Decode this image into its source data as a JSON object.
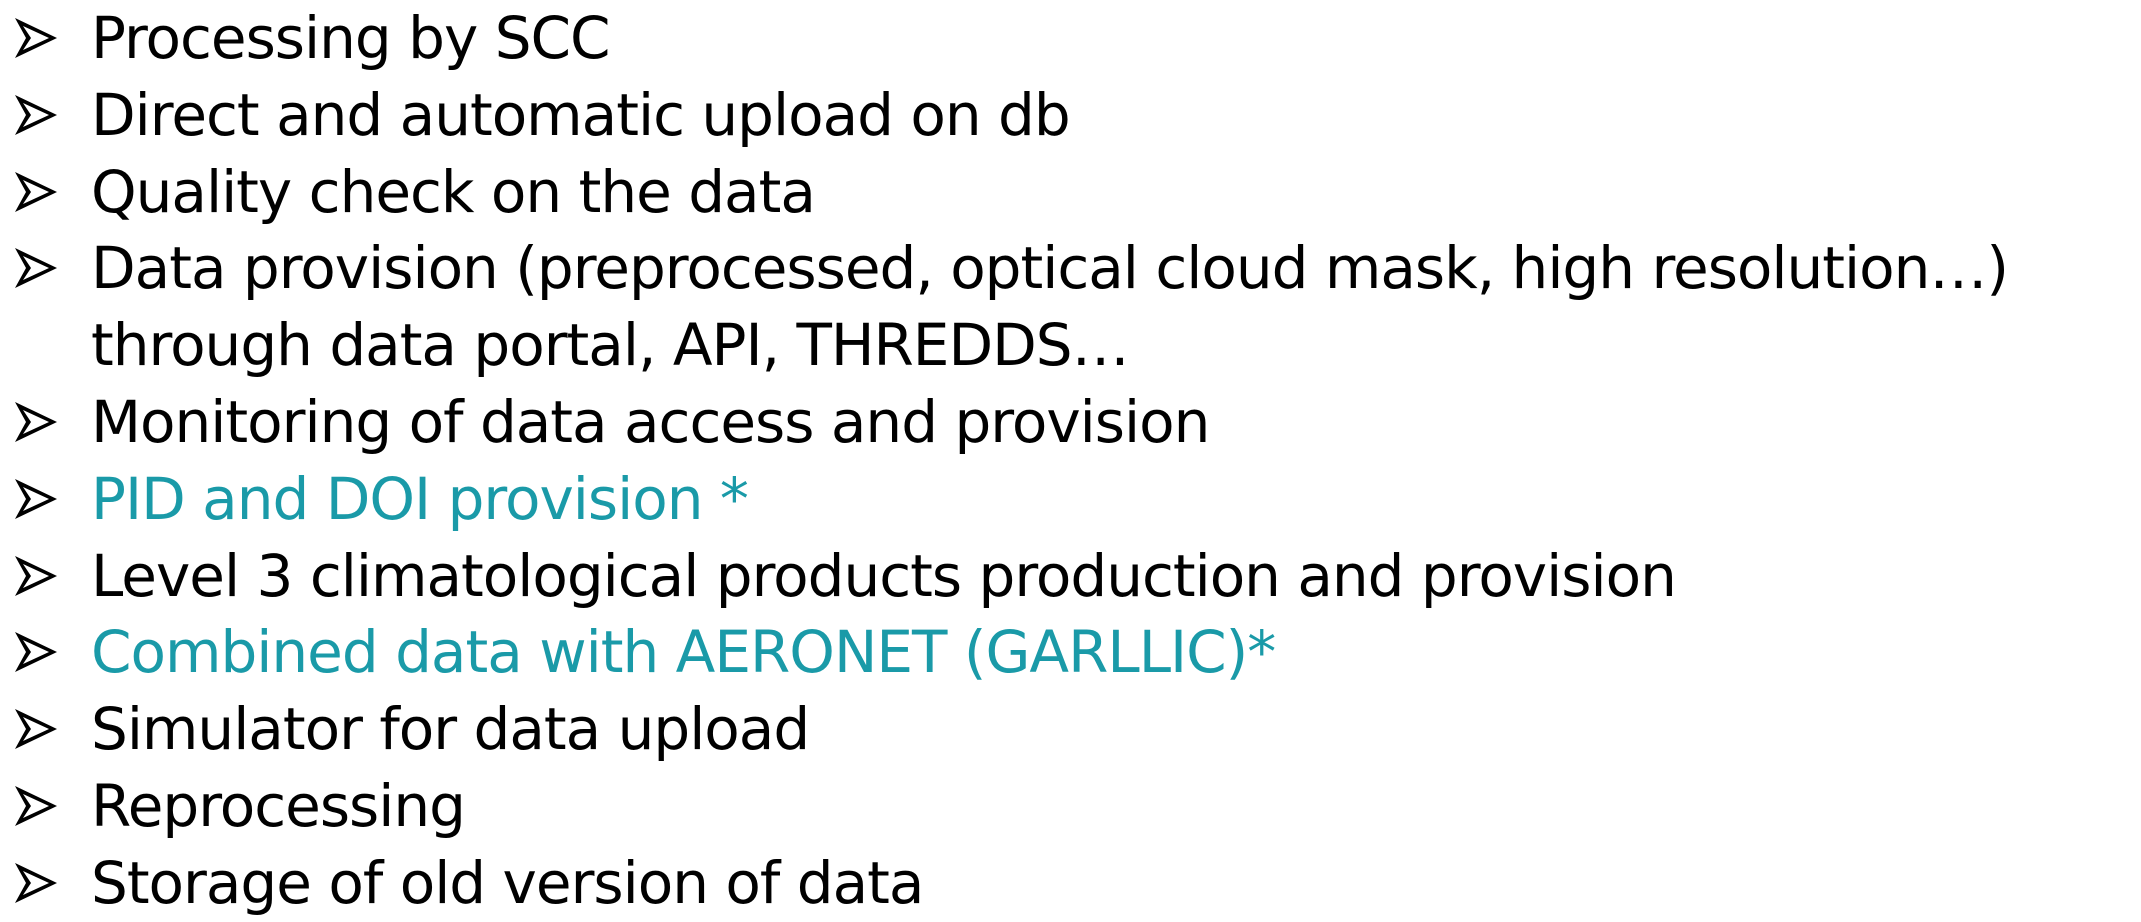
{
  "list": {
    "items": [
      {
        "text": "Processing by SCC",
        "accent": false
      },
      {
        "text": "Direct and automatic upload on db",
        "accent": false
      },
      {
        "text": "Quality check on the data",
        "accent": false
      },
      {
        "text": "Data provision (preprocessed, optical cloud mask, high resolution…) through data portal, API, THREDDS…",
        "accent": false
      },
      {
        "text": "Monitoring of data access and provision",
        "accent": false
      },
      {
        "text": "PID and DOI provision *",
        "accent": true
      },
      {
        "text": "Level 3 climatological products production and provision",
        "accent": false
      },
      {
        "text": "Combined data with AERONET (GARLLIC)*",
        "accent": true
      },
      {
        "text": "Simulator for data upload",
        "accent": false
      },
      {
        "text": "Reprocessing",
        "accent": false
      },
      {
        "text": "Storage of old version of data",
        "accent": false
      }
    ]
  },
  "colors": {
    "text": "#000000",
    "accent": "#1a9aa8"
  },
  "icons": {
    "bullet": "arrowhead-bullet-icon"
  }
}
